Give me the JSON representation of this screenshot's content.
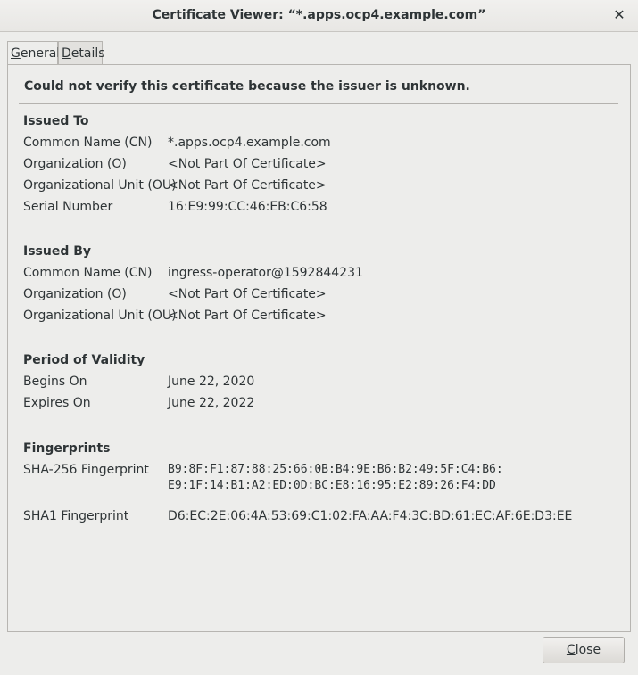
{
  "window": {
    "title": "Certificate Viewer: “*.apps.ocp4.example.com”",
    "close_glyph": "✕"
  },
  "tabs": [
    {
      "label_first": "G",
      "label_rest": "eneral"
    },
    {
      "label_first": "D",
      "label_rest": "etails"
    }
  ],
  "warning": "Could not verify this certificate because the issuer is unknown.",
  "issued_to": {
    "heading": "Issued To",
    "rows": [
      {
        "label": "Common Name (CN)",
        "value": "*.apps.ocp4.example.com"
      },
      {
        "label": "Organization (O)",
        "value": "<Not Part Of Certificate>"
      },
      {
        "label": "Organizational Unit (OU)",
        "value": "<Not Part Of Certificate>"
      },
      {
        "label": "Serial Number",
        "value": "16:E9:99:CC:46:EB:C6:58"
      }
    ]
  },
  "issued_by": {
    "heading": "Issued By",
    "rows": [
      {
        "label": "Common Name (CN)",
        "value": "ingress-operator@1592844231"
      },
      {
        "label": "Organization (O)",
        "value": "<Not Part Of Certificate>"
      },
      {
        "label": "Organizational Unit (OU)",
        "value": "<Not Part Of Certificate>"
      }
    ]
  },
  "validity": {
    "heading": "Period of Validity",
    "rows": [
      {
        "label": "Begins On",
        "value": "June 22, 2020"
      },
      {
        "label": "Expires On",
        "value": "June 22, 2022"
      }
    ]
  },
  "fingerprints": {
    "heading": "Fingerprints",
    "sha256_label": "SHA-256 Fingerprint",
    "sha256_line1": "B9:8F:F1:87:88:25:66:0B:B4:9E:B6:B2:49:5F:C4:B6:",
    "sha256_line2": "E9:1F:14:B1:A2:ED:0D:BC:E8:16:95:E2:89:26:F4:DD",
    "sha1_label": "SHA1 Fingerprint",
    "sha1_value": "D6:EC:2E:06:4A:53:69:C1:02:FA:AA:F4:3C:BD:61:EC:AF:6E:D3:EE"
  },
  "buttons": {
    "close_first": "C",
    "close_rest": "lose"
  }
}
